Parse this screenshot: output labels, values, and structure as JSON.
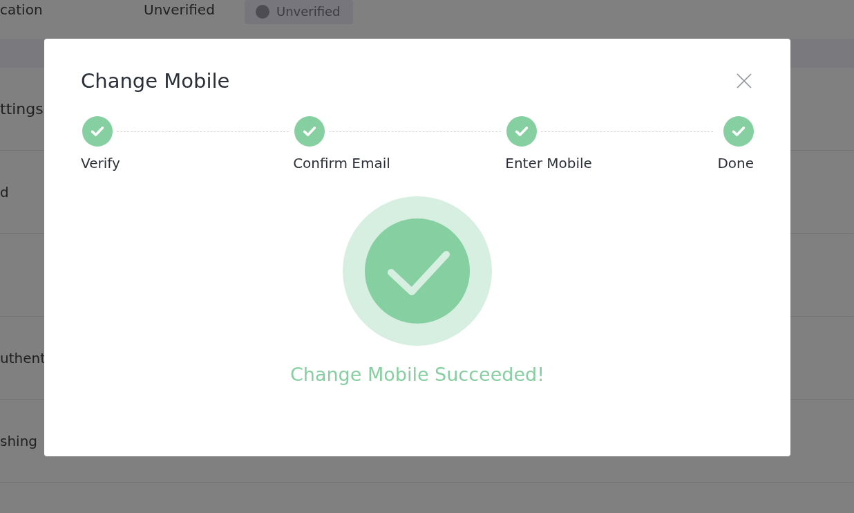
{
  "background": {
    "top_row": {
      "label": "cation",
      "value": "Unverified",
      "badge": "Unverified"
    },
    "section_title": "ttings",
    "rows": [
      {
        "label": "d"
      },
      {
        "label": ""
      },
      {
        "label": "uthent"
      },
      {
        "label": "shing"
      }
    ]
  },
  "dialog": {
    "title": "Change Mobile",
    "steps": [
      {
        "label": "Verify",
        "done": true
      },
      {
        "label": "Confirm Email",
        "done": true
      },
      {
        "label": "Enter Mobile",
        "done": true
      },
      {
        "label": "Done",
        "done": true
      }
    ],
    "result": {
      "kind": "success",
      "message": "Change Mobile Succeeded!"
    }
  }
}
